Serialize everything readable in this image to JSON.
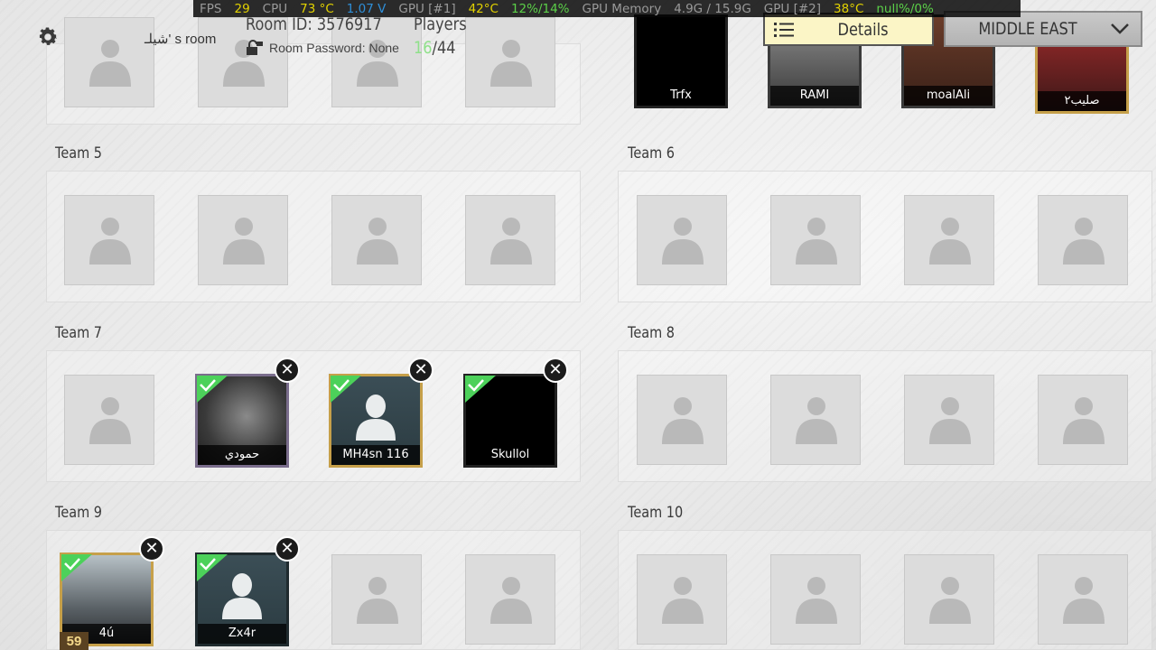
{
  "perf": {
    "fps_label": "FPS",
    "fps": "29",
    "cpu_label": "CPU",
    "cpu_temp": "73 °C",
    "cpu_volt": "1.07 V",
    "gpu1_label": "GPU [#1]",
    "gpu1_temp": "42°C",
    "gpu1_load": "12%/14%",
    "gpumem_label": "GPU Memory",
    "gpumem": "4.9G / 15.9G",
    "gpu2_label": "GPU [#2]",
    "gpu2_temp": "38°C",
    "gpu2_load": "null%/0%"
  },
  "header": {
    "room_name": "شيلـ' s room",
    "room_id": "Room ID: 3576917",
    "room_password": "Room Password: None",
    "players_label": "Players",
    "players_current": "16",
    "players_max": "/44",
    "details_label": "Details",
    "region_label": "MIDDLE EAST"
  },
  "teams": {
    "t5": "Team 5",
    "t6": "Team 6",
    "t7": "Team 7",
    "t8": "Team 8",
    "t9": "Team 9",
    "t10": "Team 10"
  },
  "players": {
    "trfx": "Trfx",
    "rami": "RAMI",
    "moalali": "moalAli",
    "salib": "صليب٢",
    "hamoudi": "حمودي",
    "mh4sn": "MH4sn 116",
    "skullol": "Skullol",
    "p4u": "4ú",
    "zx4r": "Zx4r"
  },
  "level_badge": "59",
  "icons": {
    "gear": "gear-icon",
    "lock": "lock-icon",
    "list": "list-icon",
    "chevron": "chevron-down-icon",
    "check": "check-icon",
    "close": "close-icon"
  },
  "colors": {
    "players_current": "#8fe08a",
    "details_bg": "#fbf5c6",
    "check": "#4cd15a"
  }
}
